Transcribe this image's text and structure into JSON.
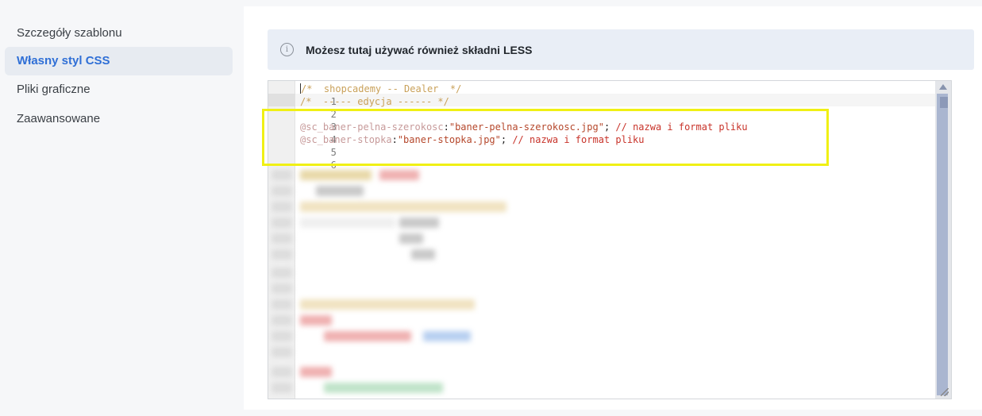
{
  "sidebar": {
    "items": [
      {
        "label": "Szczegóły szablonu",
        "active": false
      },
      {
        "label": "Własny styl CSS",
        "active": true
      },
      {
        "label": "Pliki graficzne",
        "active": false
      },
      {
        "label": "Zaawansowane",
        "active": false
      }
    ]
  },
  "info": {
    "icon": "info-icon",
    "text": "Możesz tutaj używać również składni LESS"
  },
  "editor": {
    "line_numbers": [
      "1",
      "2",
      "3",
      "4",
      "5",
      "6"
    ],
    "line1": "/*  shopcademy -- Dealer  */",
    "line2": "/*  ----- edycja ------ */",
    "line4_var": "@sc_baner-pelna-szerokosc",
    "line4_colon": ":",
    "line4_str": "\"baner-pelna-szerokosc.jpg\"",
    "line4_semi": "; ",
    "line4_comment": "// nazwa i format pliku",
    "line5_var": "@sc_baner-stopka",
    "line5_colon": ":",
    "line5_str": "\"baner-stopka.jpg\"",
    "line5_semi": "; ",
    "line5_comment": "// nazwa i format pliku"
  },
  "colors": {
    "accent": "#2f6fd6",
    "highlight_box": "#f0f014"
  }
}
